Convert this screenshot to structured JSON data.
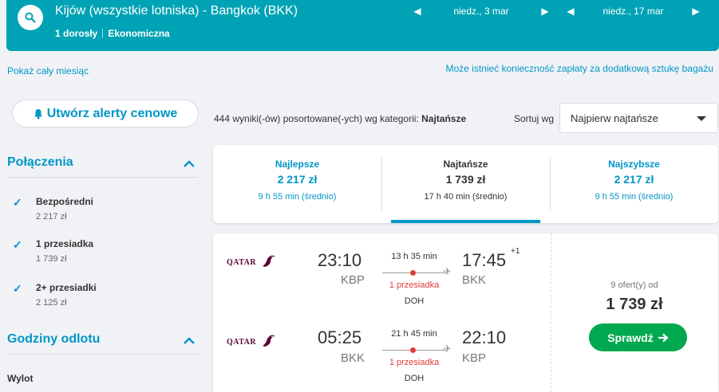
{
  "header": {
    "route": "Kijów (wszystkie lotniska) - Bangkok (BKK)",
    "passengers": "1 dorosły",
    "cabin": "Ekonomiczna",
    "outbound_date": "niedz., 3 mar",
    "return_date": "niedz., 17 mar"
  },
  "links": {
    "show_month": "Pokaż cały miesiąc",
    "baggage_note": "Może istnieć konieczność zapłaty za dodatkową sztukę bagażu"
  },
  "alert_button": "Utwórz alerty cenowe",
  "results": {
    "count_text": "444 wyniki(-ów) posortowane(-ych) wg kategorii:",
    "category": "Najtańsze",
    "sort_label": "Sortuj wg",
    "sort_value": "Najpierw najtańsze"
  },
  "sidebar": {
    "connections_title": "Połączenia",
    "filters": [
      {
        "label": "Bezpośredni",
        "price": "2 217 zł",
        "checked": true
      },
      {
        "label": "1 przesiadka",
        "price": "1 739 zł",
        "checked": true
      },
      {
        "label": "2+ przesiadki",
        "price": "2 125 zł",
        "checked": true
      }
    ],
    "departure_title": "Godziny odlotu",
    "departure_sub": "Wylot"
  },
  "tabs": [
    {
      "title": "Najlepsze",
      "price": "2 217 zł",
      "time": "9 h 55 min (średnio)"
    },
    {
      "title": "Najtańsze",
      "price": "1 739 zł",
      "time": "17 h 40 min (średnio)"
    },
    {
      "title": "Najszybsze",
      "price": "2 217 zł",
      "time": "9 h 55 min (średnio)"
    }
  ],
  "result_card": {
    "airline": "QATAR",
    "legs": [
      {
        "dep_time": "23:10",
        "dep_code": "KBP",
        "duration": "13 h 35 min",
        "stops": "1 przesiadka",
        "via": "DOH",
        "arr_time": "17:45",
        "arr_code": "BKK",
        "day_offset": "+1"
      },
      {
        "dep_time": "05:25",
        "dep_code": "BKK",
        "duration": "21 h 45 min",
        "stops": "1 przesiadka",
        "via": "DOH",
        "arr_time": "22:10",
        "arr_code": "KBP",
        "day_offset": ""
      }
    ],
    "offers": "9 ofert(y) od",
    "price": "1 739 zł",
    "button": "Sprawdź"
  },
  "colors": {
    "header_bg": "#00a3b5",
    "link": "#0096c7",
    "stops": "#e23b3b",
    "cta": "#00a94f"
  }
}
